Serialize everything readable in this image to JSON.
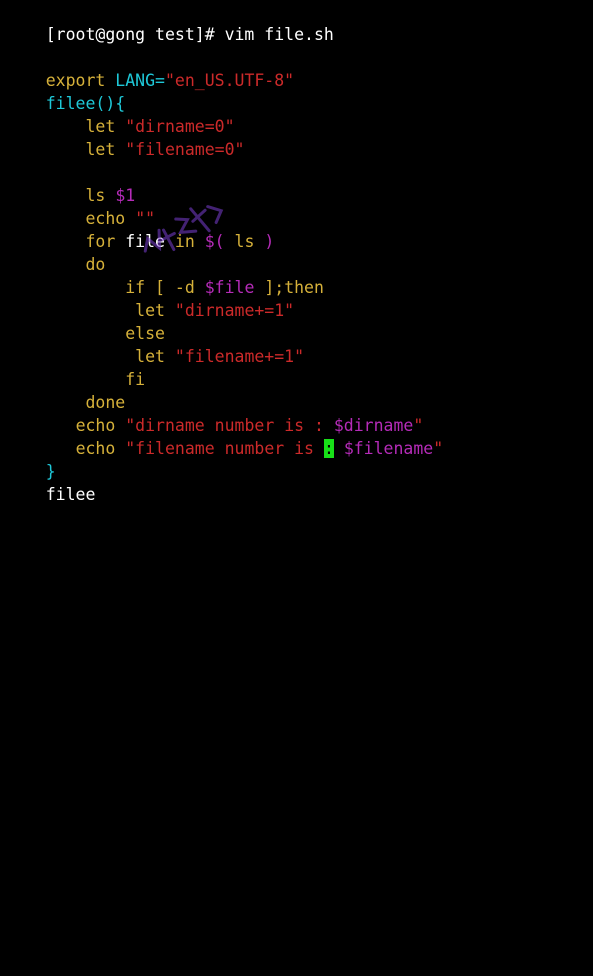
{
  "terminal": {
    "prompt": "[root@gong test]# ",
    "command": "vim file.sh",
    "lines": [
      {
        "indent": "",
        "t1": "export",
        "t2": " LANG=",
        "t3": "\"en_US.UTF-8\""
      },
      {
        "indent": "",
        "t1": "filee(){"
      },
      {
        "indent": "    ",
        "t1": "let",
        "t2": " ",
        "t3": "\"dirname=0\""
      },
      {
        "indent": "    ",
        "t1": "let",
        "t2": " ",
        "t3": "\"filename=0\""
      },
      {
        "indent": "    ",
        "t1": "ls",
        "t2": " ",
        "t3": "$1"
      },
      {
        "indent": "    ",
        "t1": "echo",
        "t2": " ",
        "t3": "\"\""
      },
      {
        "indent": "    ",
        "t1": "for",
        "t2": " file ",
        "t3": "in",
        "t4": " ",
        "t5": "$(",
        "t6": " ls ",
        "t7": ")"
      },
      {
        "indent": "    ",
        "t1": "do"
      },
      {
        "indent": "        ",
        "t1": "if",
        "t2": " [ -d ",
        "t3": "$file",
        "t4": " ];then"
      },
      {
        "indent": "         ",
        "t1": "let",
        "t2": " ",
        "t3": "\"dirname+=1\""
      },
      {
        "indent": "        ",
        "t1": "else"
      },
      {
        "indent": "         ",
        "t1": "let",
        "t2": " ",
        "t3": "\"filename+=1\""
      },
      {
        "indent": "        ",
        "t1": "fi"
      },
      {
        "indent": "    ",
        "t1": "done"
      },
      {
        "indent": "   ",
        "t1": "echo",
        "t2": " ",
        "t3": "\"dirname number is : ",
        "t4": "$dirname",
        "t5": "\""
      },
      {
        "indent": "   ",
        "t1": "echo",
        "t2": " ",
        "t3": "\"filename number is ",
        "t4": ":",
        "t5": " ",
        "t6": "$filename",
        "t7": "\""
      },
      {
        "indent": "",
        "t1": "}"
      },
      {
        "indent": "",
        "t1": "filee"
      }
    ]
  },
  "colors": {
    "background": "#000000",
    "text": "#ffffff",
    "string": "#cc2a2a",
    "keyword": "#d6b13a",
    "variable": "#b52bb8",
    "function": "#1ec8d8",
    "cursor": "#18e018"
  },
  "watermark": {
    "icon": "watermark-stamp"
  }
}
